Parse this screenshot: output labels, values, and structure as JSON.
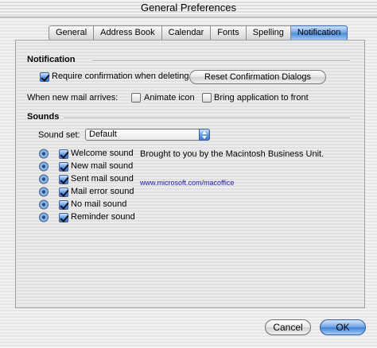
{
  "window": {
    "title": "General Preferences"
  },
  "tabs": [
    {
      "label": "General"
    },
    {
      "label": "Address Book"
    },
    {
      "label": "Calendar"
    },
    {
      "label": "Fonts"
    },
    {
      "label": "Spelling"
    },
    {
      "label": "Notification",
      "active": true
    }
  ],
  "notification": {
    "section_title": "Notification",
    "require_confirmation": {
      "label": "Require confirmation when deleting",
      "checked": true
    },
    "reset_button": "Reset Confirmation Dialogs",
    "new_mail_label": "When new mail arrives:",
    "animate_icon": {
      "label": "Animate icon",
      "checked": false
    },
    "bring_to_front": {
      "label": "Bring application to front",
      "checked": false
    }
  },
  "sounds": {
    "section_title": "Sounds",
    "sound_set_label": "Sound set:",
    "sound_set_value": "Default",
    "items": [
      {
        "label": "Welcome sound",
        "checked": true
      },
      {
        "label": "New mail sound",
        "checked": true
      },
      {
        "label": "Sent mail sound",
        "checked": true
      },
      {
        "label": "Mail error sound",
        "checked": true
      },
      {
        "label": "No mail sound",
        "checked": true
      },
      {
        "label": "Reminder sound",
        "checked": true
      }
    ],
    "credit": "Brought to you by the Macintosh Business Unit.",
    "link": "www.microsoft.com/macoffice"
  },
  "buttons": {
    "cancel": "Cancel",
    "ok": "OK"
  },
  "colors": {
    "accent": "#4b8ad8",
    "link": "#1a1aa6"
  }
}
